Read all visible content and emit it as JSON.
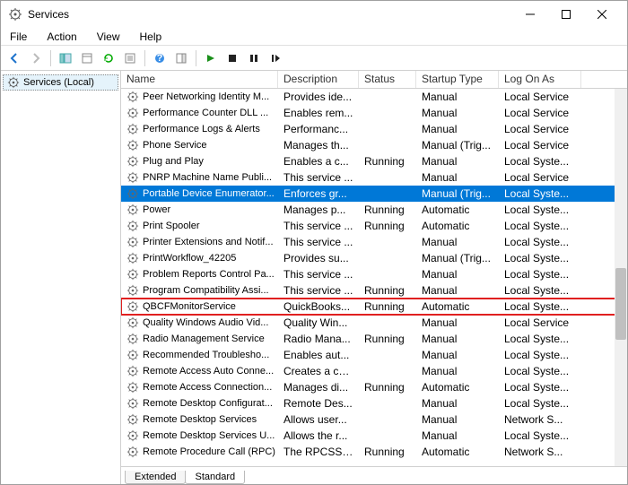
{
  "window": {
    "title": "Services"
  },
  "menu": [
    "File",
    "Action",
    "View",
    "Help"
  ],
  "tree": {
    "root": "Services (Local)"
  },
  "columns": {
    "name": "Name",
    "desc": "Description",
    "status": "Status",
    "startup": "Startup Type",
    "logon": "Log On As"
  },
  "tabs": {
    "extended": "Extended",
    "standard": "Standard"
  },
  "services": [
    {
      "name": "Peer Networking Identity M...",
      "desc": "Provides ide...",
      "status": "",
      "startup": "Manual",
      "logon": "Local Service"
    },
    {
      "name": "Performance Counter DLL ...",
      "desc": "Enables rem...",
      "status": "",
      "startup": "Manual",
      "logon": "Local Service"
    },
    {
      "name": "Performance Logs & Alerts",
      "desc": "Performanc...",
      "status": "",
      "startup": "Manual",
      "logon": "Local Service"
    },
    {
      "name": "Phone Service",
      "desc": "Manages th...",
      "status": "",
      "startup": "Manual (Trig...",
      "logon": "Local Service"
    },
    {
      "name": "Plug and Play",
      "desc": "Enables a c...",
      "status": "Running",
      "startup": "Manual",
      "logon": "Local Syste..."
    },
    {
      "name": "PNRP Machine Name Publi...",
      "desc": "This service ...",
      "status": "",
      "startup": "Manual",
      "logon": "Local Service"
    },
    {
      "name": "Portable Device Enumerator...",
      "desc": "Enforces gr...",
      "status": "",
      "startup": "Manual (Trig...",
      "logon": "Local Syste...",
      "selected": true
    },
    {
      "name": "Power",
      "desc": "Manages p...",
      "status": "Running",
      "startup": "Automatic",
      "logon": "Local Syste..."
    },
    {
      "name": "Print Spooler",
      "desc": "This service ...",
      "status": "Running",
      "startup": "Automatic",
      "logon": "Local Syste..."
    },
    {
      "name": "Printer Extensions and Notif...",
      "desc": "This service ...",
      "status": "",
      "startup": "Manual",
      "logon": "Local Syste..."
    },
    {
      "name": "PrintWorkflow_42205",
      "desc": "Provides su...",
      "status": "",
      "startup": "Manual (Trig...",
      "logon": "Local Syste..."
    },
    {
      "name": "Problem Reports Control Pa...",
      "desc": "This service ...",
      "status": "",
      "startup": "Manual",
      "logon": "Local Syste..."
    },
    {
      "name": "Program Compatibility Assi...",
      "desc": "This service ...",
      "status": "Running",
      "startup": "Manual",
      "logon": "Local Syste..."
    },
    {
      "name": "QBCFMonitorService",
      "desc": "QuickBooks...",
      "status": "Running",
      "startup": "Automatic",
      "logon": "Local Syste...",
      "highlight": true
    },
    {
      "name": "Quality Windows Audio Vid...",
      "desc": "Quality Win...",
      "status": "",
      "startup": "Manual",
      "logon": "Local Service"
    },
    {
      "name": "Radio Management Service",
      "desc": "Radio Mana...",
      "status": "Running",
      "startup": "Manual",
      "logon": "Local Syste..."
    },
    {
      "name": "Recommended Troublesho...",
      "desc": "Enables aut...",
      "status": "",
      "startup": "Manual",
      "logon": "Local Syste..."
    },
    {
      "name": "Remote Access Auto Conne...",
      "desc": "Creates a co...",
      "status": "",
      "startup": "Manual",
      "logon": "Local Syste..."
    },
    {
      "name": "Remote Access Connection...",
      "desc": "Manages di...",
      "status": "Running",
      "startup": "Automatic",
      "logon": "Local Syste..."
    },
    {
      "name": "Remote Desktop Configurat...",
      "desc": "Remote Des...",
      "status": "",
      "startup": "Manual",
      "logon": "Local Syste..."
    },
    {
      "name": "Remote Desktop Services",
      "desc": "Allows user...",
      "status": "",
      "startup": "Manual",
      "logon": "Network S..."
    },
    {
      "name": "Remote Desktop Services U...",
      "desc": "Allows the r...",
      "status": "",
      "startup": "Manual",
      "logon": "Local Syste..."
    },
    {
      "name": "Remote Procedure Call (RPC)",
      "desc": "The RPCSS ...",
      "status": "Running",
      "startup": "Automatic",
      "logon": "Network S..."
    }
  ]
}
